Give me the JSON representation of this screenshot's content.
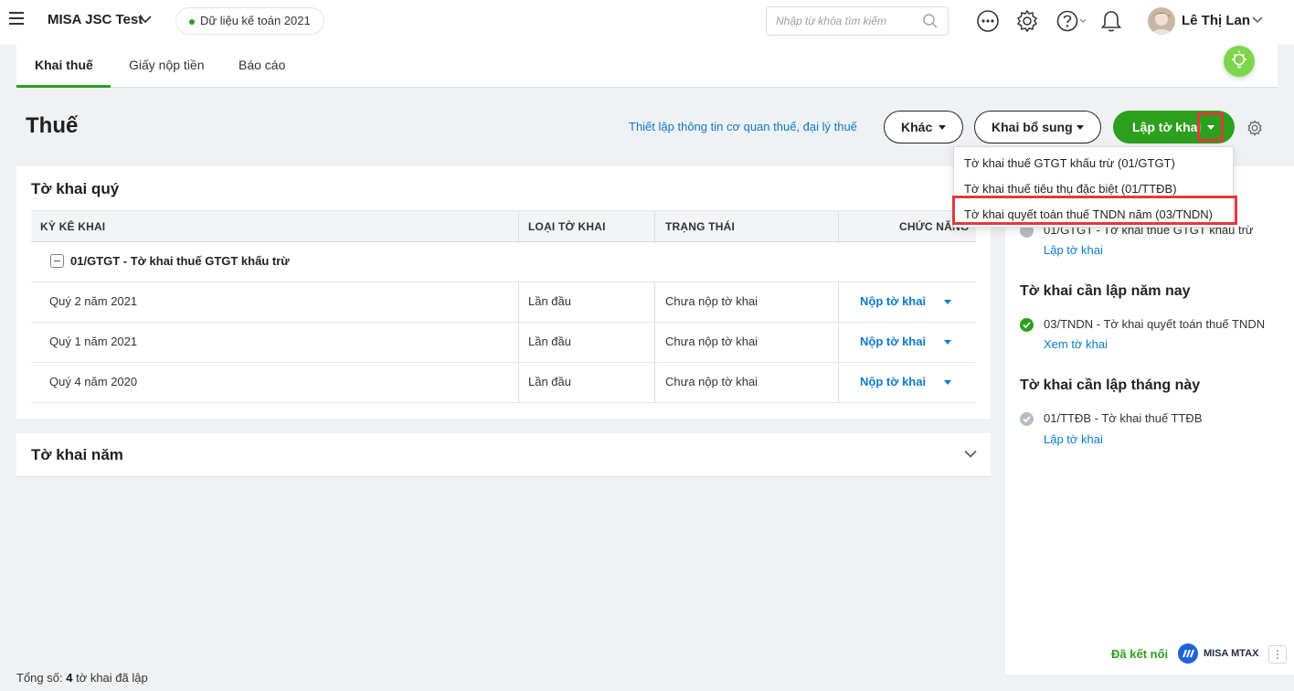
{
  "topbar": {
    "company": "MISA JSC Test",
    "data_label": "Dữ liệu kế toán 2021",
    "search_placeholder": "Nhập từ khóa tìm kiếm",
    "username": "Lê Thị Lan"
  },
  "tabs": [
    {
      "label": "Khai thuế",
      "active": true
    },
    {
      "label": "Giấy nộp tiền",
      "active": false
    },
    {
      "label": "Báo cáo",
      "active": false
    }
  ],
  "page": {
    "title": "Thuế",
    "setup_link": "Thiết lập thông tin cơ quan thuế, đại lý thuế",
    "btn_other": "Khác",
    "btn_supplement": "Khai bổ sung",
    "btn_create": "Lập tờ khai"
  },
  "dropdown": {
    "items": [
      "Tờ khai thuế GTGT khấu trừ (01/GTGT)",
      "Tờ khai thuế tiêu thụ đặc biệt (01/TTĐB)",
      "Tờ khai quyết toán thuế TNDN năm (03/TNDN)"
    ]
  },
  "quarterly": {
    "title": "Tờ khai quý",
    "columns": [
      "KỲ KÊ KHAI",
      "LOẠI TỜ KHAI",
      "TRẠNG THÁI",
      "CHỨC NĂNG"
    ],
    "group": "01/GTGT - Tờ khai thuế GTGT khấu trừ",
    "rows": [
      {
        "period": "Quý 2 năm 2021",
        "type": "Lần đầu",
        "status": "Chưa nộp tờ khai",
        "action": "Nộp tờ khai"
      },
      {
        "period": "Quý 1 năm 2021",
        "type": "Lần đầu",
        "status": "Chưa nộp tờ khai",
        "action": "Nộp tờ khai"
      },
      {
        "period": "Quý 4 năm 2020",
        "type": "Lần đầu",
        "status": "Chưa nộp tờ khai",
        "action": "Nộp tờ khai"
      }
    ]
  },
  "yearly": {
    "title": "Tờ khai năm"
  },
  "right_panel": {
    "first_item": "01/GTGT - Tờ khai thuế GTGT khấu trừ",
    "first_link": "Lập tờ khai",
    "year_title": "Tờ khai cần lập năm nay",
    "year_item": "03/TNDN - Tờ khai quyết toán thuế TNDN",
    "year_link": "Xem tờ khai",
    "month_title": "Tờ khai cần lập tháng này",
    "month_item": "01/TTĐB - Tờ khai thuế TTĐB",
    "month_link": "Lập tờ khai",
    "connected": "Đã kết nối",
    "brand": "MISA MTAX"
  },
  "footer": {
    "prefix": "Tổng số:",
    "count": "4",
    "suffix": "tờ khai đã lập"
  },
  "colors": {
    "accent": "#2ca01c",
    "link": "#0a7bcc",
    "highlight": "#e03a3a"
  }
}
